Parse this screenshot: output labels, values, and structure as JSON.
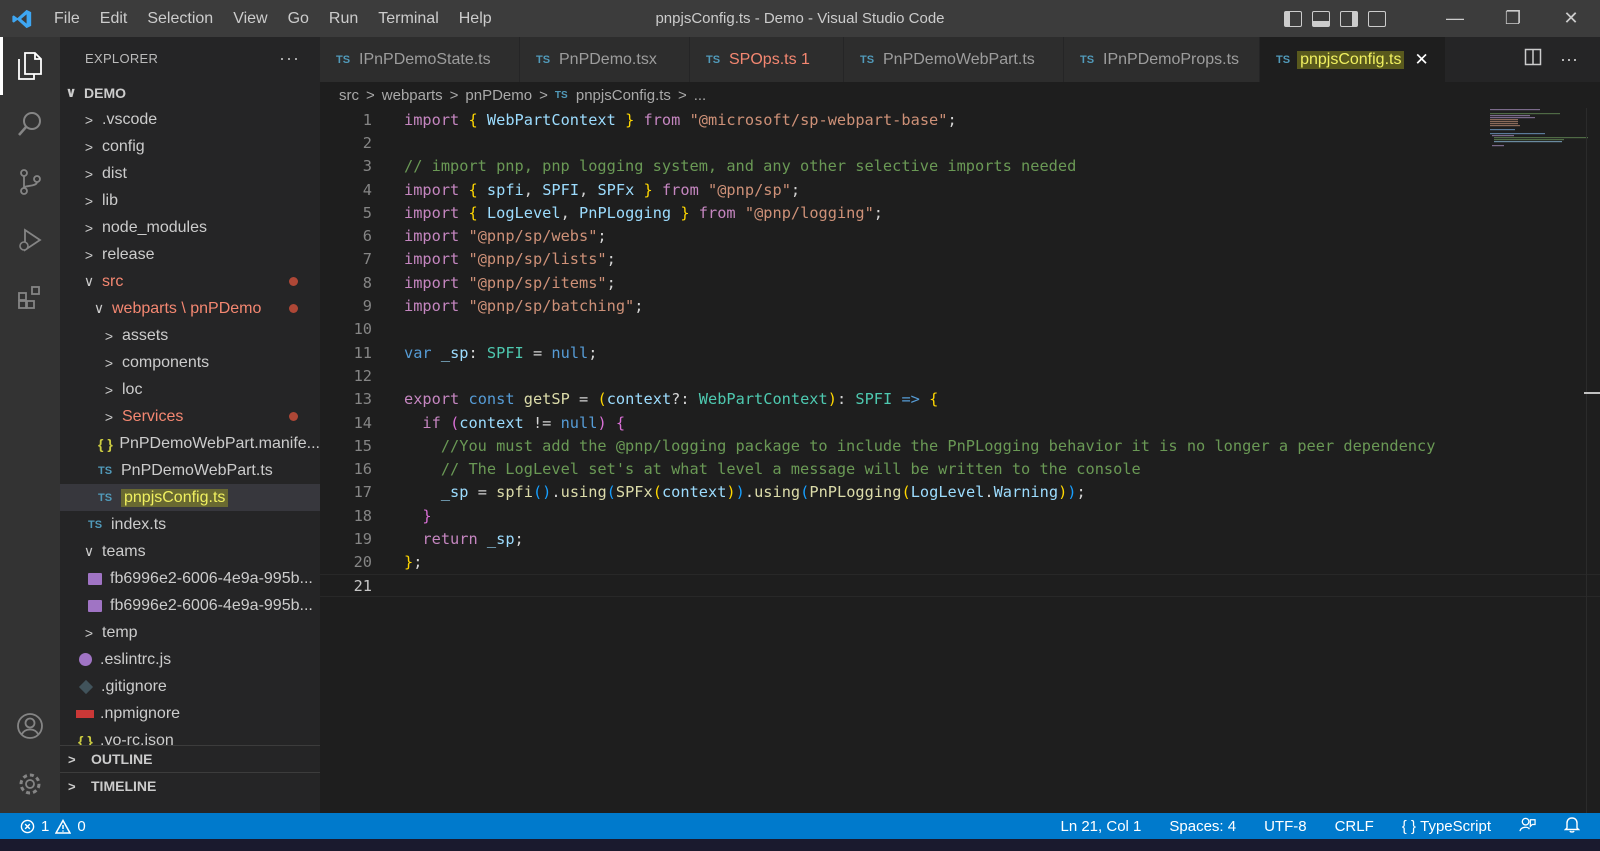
{
  "titlebar": {
    "menu": [
      "File",
      "Edit",
      "Selection",
      "View",
      "Go",
      "Run",
      "Terminal",
      "Help"
    ],
    "title": "pnpjsConfig.ts - Demo - Visual Studio Code",
    "controls": {
      "minimize": "—",
      "restore": "❐",
      "close": "✕"
    }
  },
  "sidebar": {
    "header": "EXPLORER",
    "more": "···",
    "tree": [
      {
        "label": "DEMO",
        "chevron": "∨",
        "indent": 0
      },
      {
        "label": ".vscode",
        "chevron": ">",
        "indent": 1
      },
      {
        "label": "config",
        "chevron": ">",
        "indent": 1
      },
      {
        "label": "dist",
        "chevron": ">",
        "indent": 1
      },
      {
        "label": "lib",
        "chevron": ">",
        "indent": 1
      },
      {
        "label": "node_modules",
        "chevron": ">",
        "indent": 1
      },
      {
        "label": "release",
        "chevron": ">",
        "indent": 1
      },
      {
        "label": "src",
        "chevron": "∨",
        "indent": 1
      },
      {
        "label": "webparts \\ pnPDemo",
        "chevron": "∨",
        "indent": 2
      },
      {
        "label": "assets",
        "chevron": ">",
        "indent": 3
      },
      {
        "label": "components",
        "chevron": ">",
        "indent": 3
      },
      {
        "label": "loc",
        "chevron": ">",
        "indent": 3
      },
      {
        "label": "Services",
        "chevron": ">",
        "indent": 3
      },
      {
        "label": "PnPDemoWebPart.manife...",
        "icon": "{ }",
        "indent": 3
      },
      {
        "label": "PnPDemoWebPart.ts",
        "icon": "TS",
        "indent": 3
      },
      {
        "label": "pnpjsConfig.ts",
        "icon": "TS",
        "indent": 3
      },
      {
        "label": "index.ts",
        "icon": "TS",
        "indent": 2
      },
      {
        "label": "teams",
        "chevron": "∨",
        "indent": 1
      },
      {
        "label": "fb6996e2-6006-4e9a-995b...",
        "indent": 2
      },
      {
        "label": "fb6996e2-6006-4e9a-995b...",
        "indent": 2
      },
      {
        "label": "temp",
        "chevron": ">",
        "indent": 1
      },
      {
        "label": ".eslintrc.js",
        "indent": 1
      },
      {
        "label": ".gitignore",
        "indent": 1
      },
      {
        "label": ".npmignore",
        "indent": 1
      },
      {
        "label": ".yo-rc.json",
        "icon": "{ }",
        "indent": 1
      }
    ],
    "outline": "OUTLINE",
    "timeline": "TIMELINE"
  },
  "tabs": [
    {
      "icon": "TS",
      "label": "IPnPDemoState.ts"
    },
    {
      "icon": "TS",
      "label": "PnPDemo.tsx"
    },
    {
      "icon": "TS",
      "label": "SPOps.ts 1"
    },
    {
      "icon": "TS",
      "label": "PnPDemoWebPart.ts"
    },
    {
      "icon": "TS",
      "label": "IPnPDemoProps.ts"
    },
    {
      "icon": "TS",
      "label": "pnpjsConfig.ts",
      "close": "✕"
    }
  ],
  "breadcrumb": {
    "parts": [
      "src",
      "webparts",
      "pnPDemo"
    ],
    "file_icon": "TS",
    "file": "pnpjsConfig.ts",
    "tail": "..."
  },
  "editor": {
    "line_numbers": [
      "1",
      "2",
      "3",
      "4",
      "5",
      "6",
      "7",
      "8",
      "9",
      "10",
      "11",
      "12",
      "13",
      "14",
      "15",
      "16",
      "17",
      "18",
      "19",
      "20",
      "21"
    ]
  },
  "statusbar": {
    "errors": "1",
    "warnings": "0",
    "position": "Ln 21, Col 1",
    "spaces": "Spaces: 4",
    "encoding": "UTF-8",
    "eol": "CRLF",
    "language": "TypeScript"
  },
  "colors": {
    "accent": "#007acc",
    "error": "#f48771",
    "highlight": "#e2e256"
  }
}
